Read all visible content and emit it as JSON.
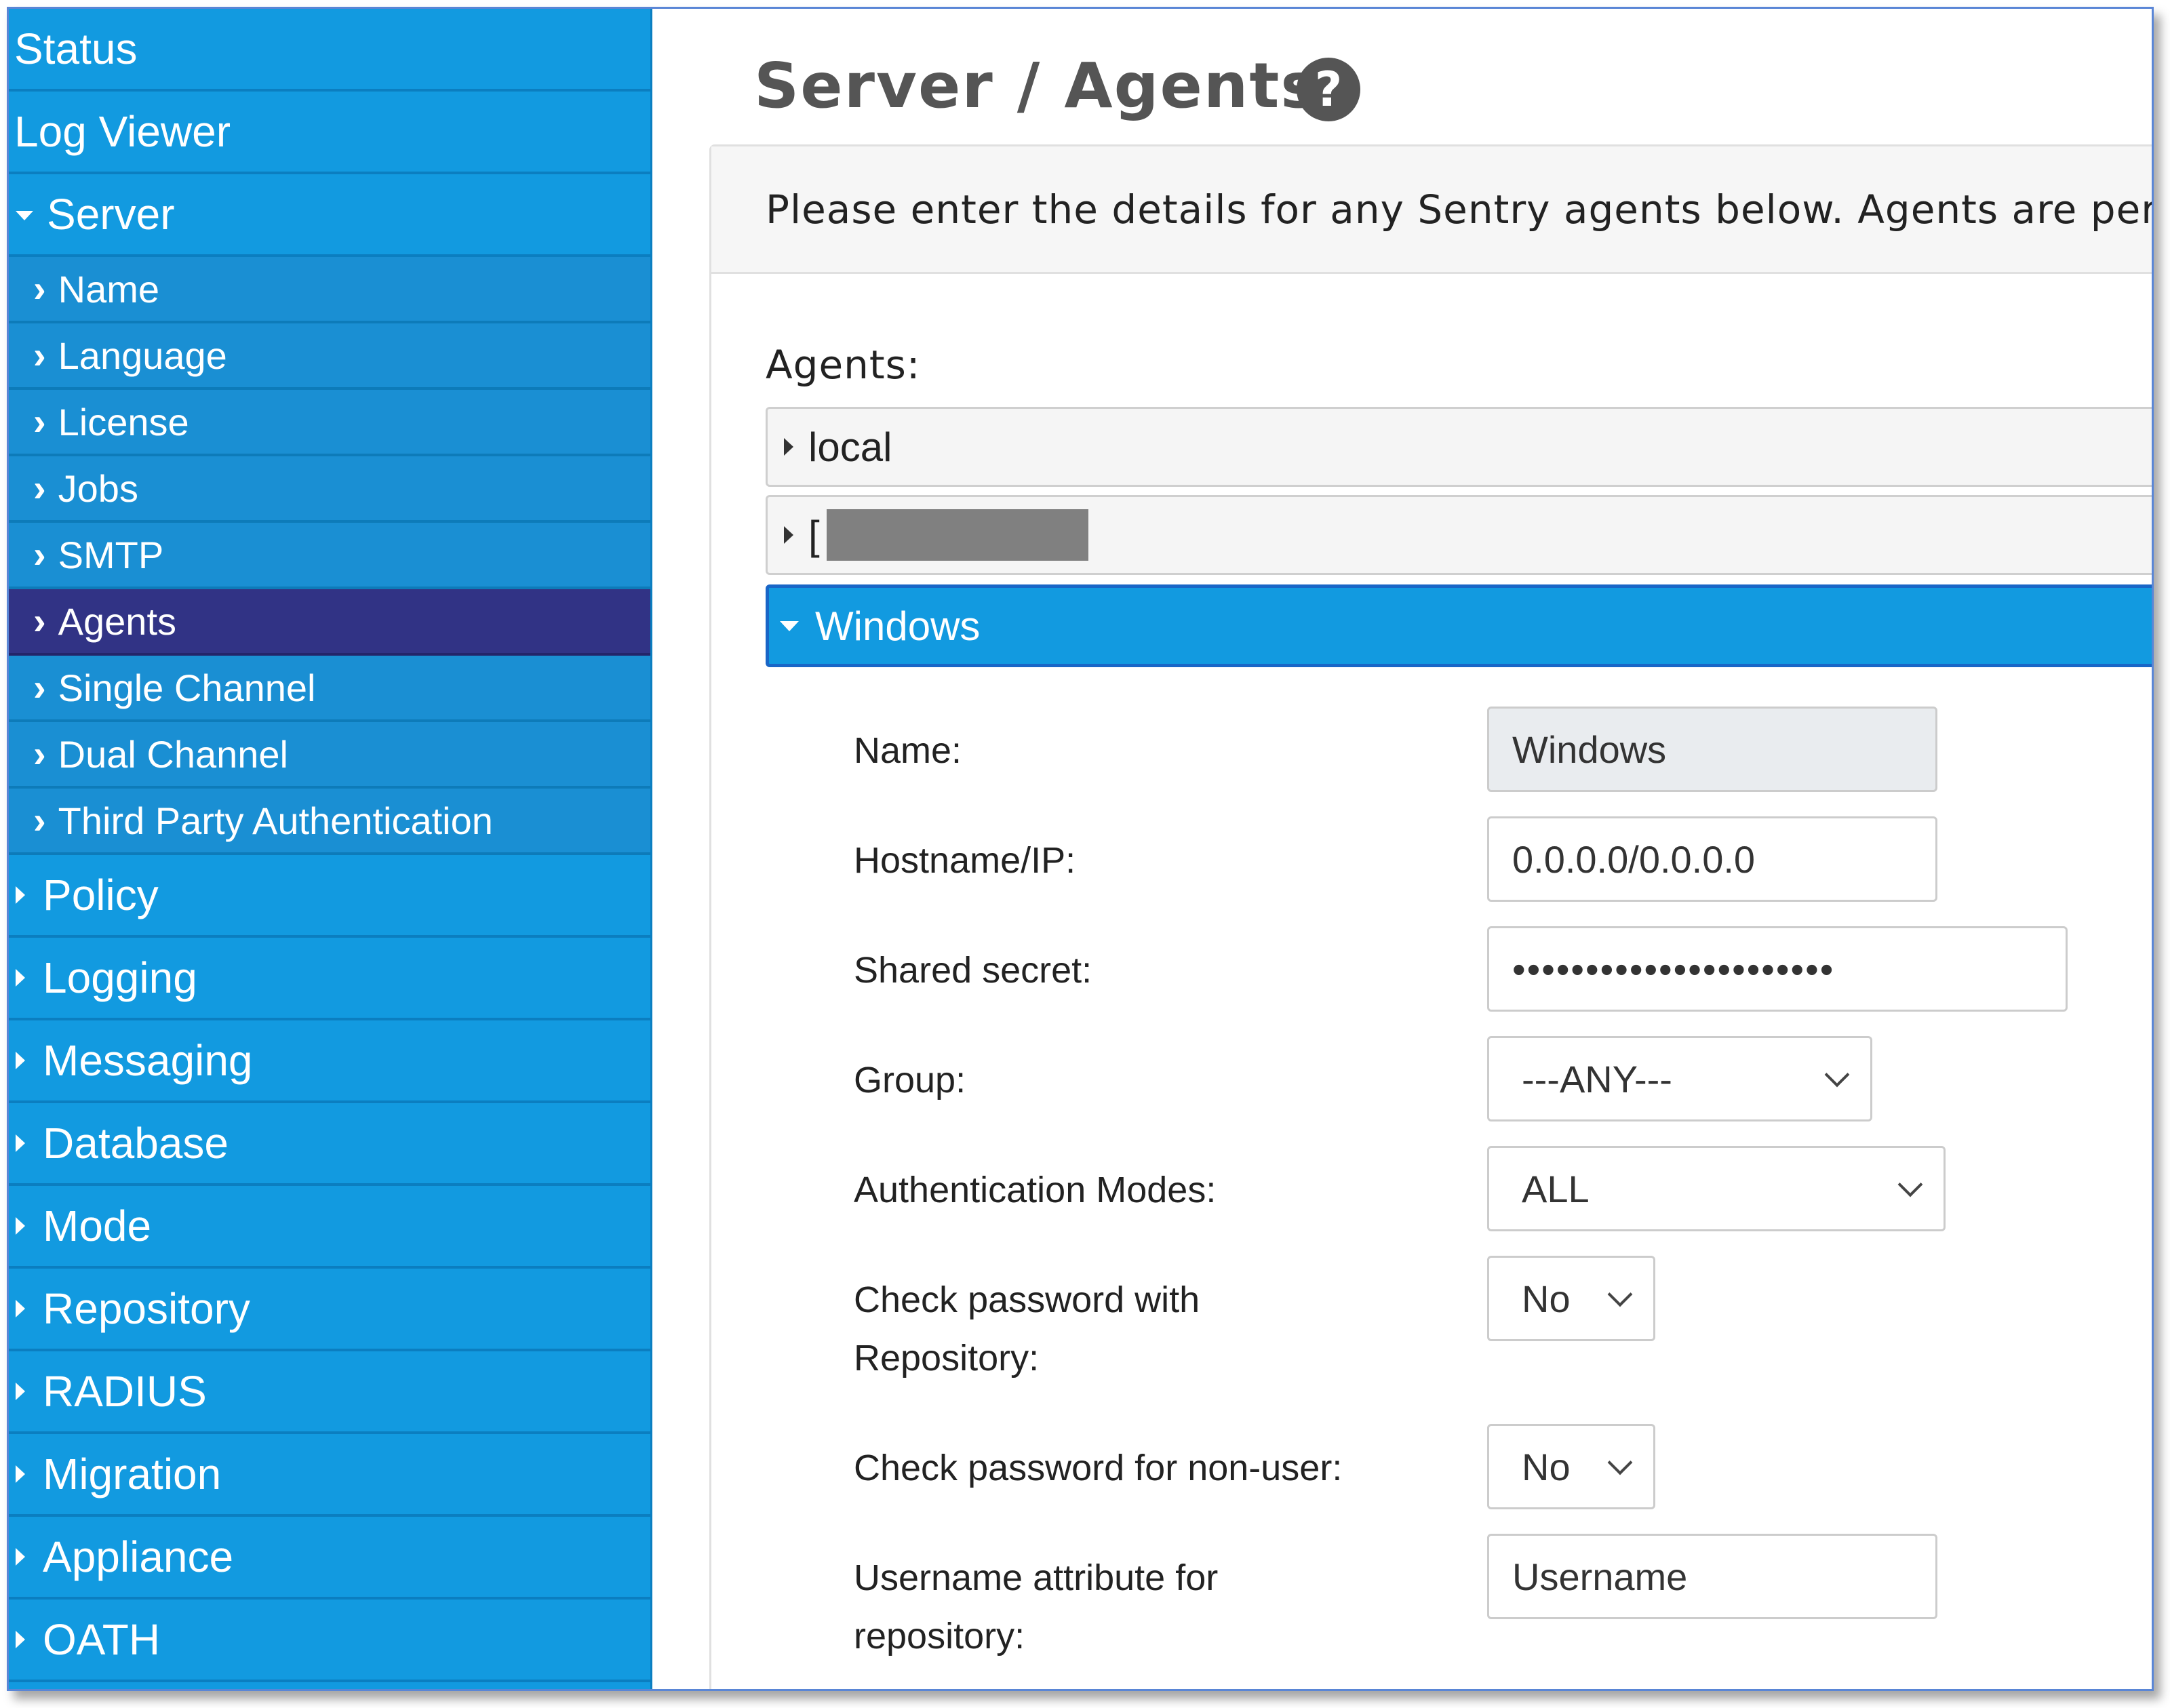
{
  "sidebar": {
    "status": "Status",
    "log_viewer": "Log Viewer",
    "server": "Server",
    "server_items": [
      "Name",
      "Language",
      "License",
      "Jobs",
      "SMTP",
      "Agents",
      "Single Channel",
      "Dual Channel",
      "Third Party Authentication"
    ],
    "sections": [
      "Policy",
      "Logging",
      "Messaging",
      "Database",
      "Mode",
      "Repository",
      "RADIUS",
      "Migration",
      "Appliance",
      "OATH"
    ],
    "active_item": "Agents"
  },
  "page": {
    "title": "Server / Agents",
    "help_glyph": "?",
    "intro": "Please enter the details for any Sentry agents below. Agents are permi"
  },
  "agents": {
    "label": "Agents:",
    "items": [
      "local",
      "[",
      "Windows"
    ]
  },
  "form": {
    "name_label": "Name:",
    "name_value": "Windows",
    "hostname_label": "Hostname/IP:",
    "hostname_value": "0.0.0.0/0.0.0.0",
    "secret_label": "Shared secret:",
    "secret_value": "••••••••••••••••••••••",
    "group_label": "Group:",
    "group_value": "---ANY---",
    "auth_modes_label": "Authentication Modes:",
    "auth_modes_value": "ALL",
    "check_repo_label_1": "Check password with",
    "check_repo_label_2": "Repository:",
    "check_repo_value": "No",
    "check_nonuser_label": "Check password for non-user:",
    "check_nonuser_value": "No",
    "username_attr_label_1": "Username attribute for",
    "username_attr_label_2": "repository:",
    "username_attr_value": "Username"
  },
  "colors": {
    "sidebar_bg": "#129ae0",
    "sidebar_active": "#313385",
    "accordion_active": "#129ae0",
    "title_text": "#555555"
  }
}
